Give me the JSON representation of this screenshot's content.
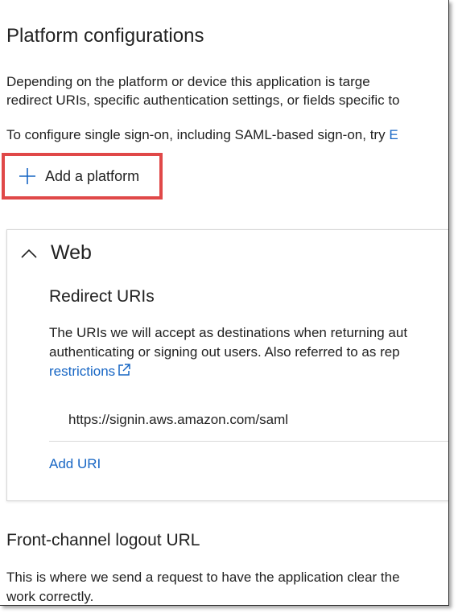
{
  "section": {
    "title": "Platform configurations",
    "description_line1": "Depending on the platform or device this application is targe",
    "description_line2": "redirect URIs, specific authentication settings, or fields specific to",
    "sso_text": "To configure single sign-on, including SAML-based sign-on, try ",
    "sso_link": "E"
  },
  "add_platform": {
    "label": "Add a platform",
    "icon": "plus-icon"
  },
  "web_card": {
    "title": "Web",
    "toggle_icon": "chevron-up-icon",
    "redirect_uris": {
      "title": "Redirect URIs",
      "desc_line1": "The URIs we will accept as destinations when returning aut",
      "desc_line2": "authenticating or signing out users. Also referred to as rep",
      "restrictions_link": "restrictions",
      "uris": [
        "https://signin.aws.amazon.com/saml"
      ],
      "add_uri": "Add URI"
    }
  },
  "front_channel": {
    "title": "Front-channel logout URL",
    "desc_line1": "This is where we send a request to have the application clear the",
    "desc_line2": "work correctly."
  },
  "colors": {
    "link": "#1766c4",
    "highlight": "#e04848"
  }
}
